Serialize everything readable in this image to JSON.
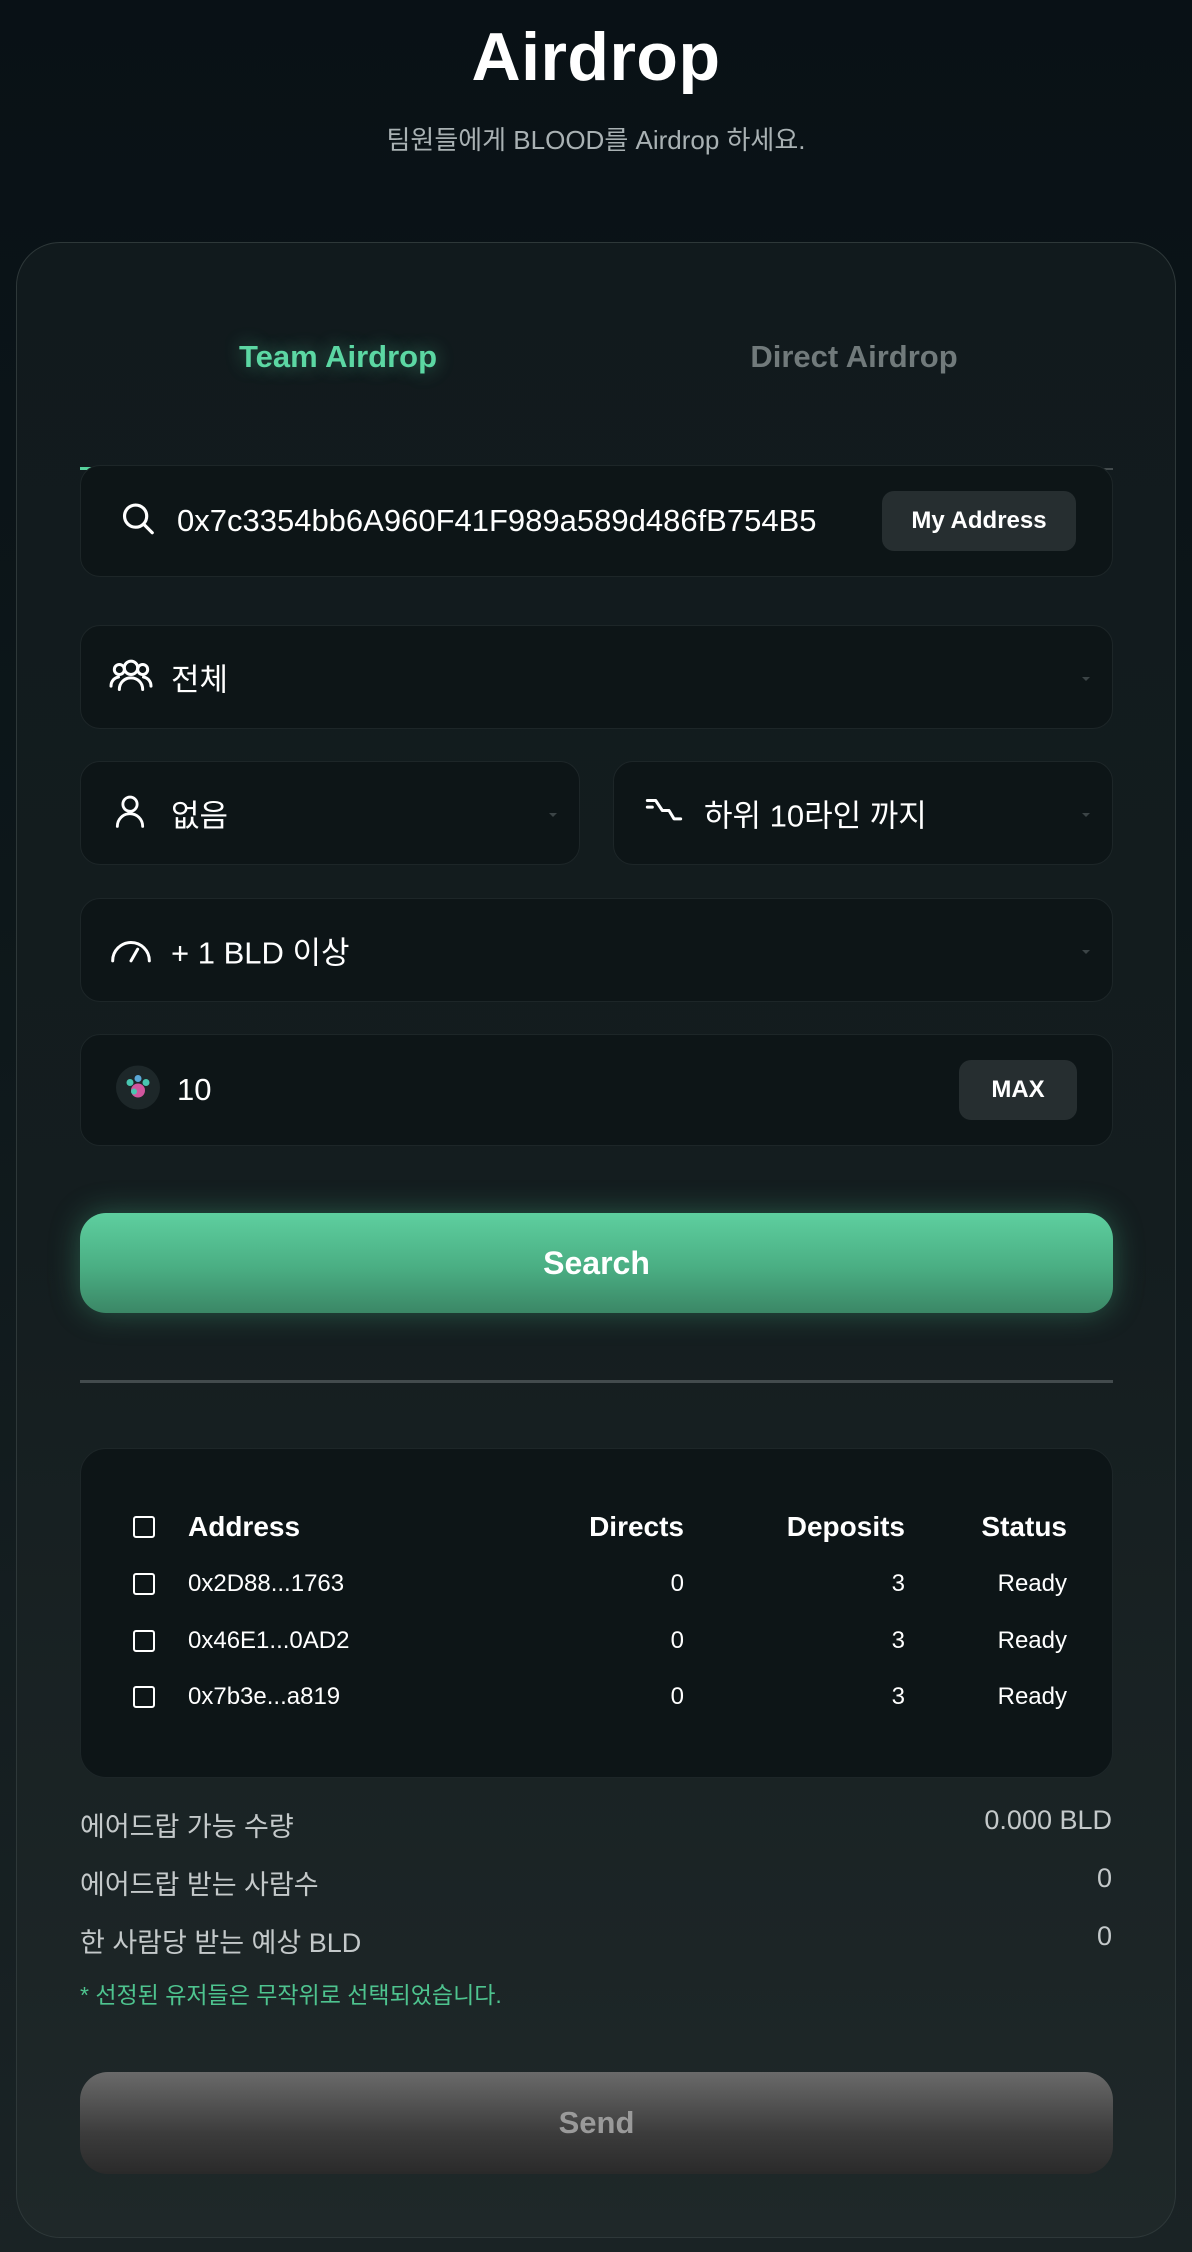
{
  "header": {
    "title": "Airdrop",
    "subtitle": "팀원들에게 BLOOD를 Airdrop 하세요."
  },
  "tabs": [
    {
      "label": "Team Airdrop",
      "active": true
    },
    {
      "label": "Direct Airdrop",
      "active": false
    }
  ],
  "search": {
    "value": "0x7c3354bb6A960F41F989a589d486fB754B5",
    "my_address_label": "My Address"
  },
  "filters": {
    "group": "전체",
    "user": "없음",
    "depth": "하위 10라인 까지",
    "min_amount": "+ 1 BLD 이상"
  },
  "amount": {
    "value": "10",
    "max_label": "MAX"
  },
  "search_button_label": "Search",
  "table": {
    "headers": [
      "Address",
      "Directs",
      "Deposits",
      "Status"
    ],
    "rows": [
      {
        "address": "0x2D88...1763",
        "directs": "0",
        "deposits": "3",
        "status": "Ready"
      },
      {
        "address": "0x46E1...0AD2",
        "directs": "0",
        "deposits": "3",
        "status": "Ready"
      },
      {
        "address": "0x7b3e...a819",
        "directs": "0",
        "deposits": "3",
        "status": "Ready"
      }
    ]
  },
  "summary": [
    {
      "label": "에어드랍 가능 수량",
      "value": "0.000 BLD"
    },
    {
      "label": "에어드랍 받는 사람수",
      "value": "0"
    },
    {
      "label": "한 사람당 받는 예상 BLD",
      "value": "0"
    }
  ],
  "note": "* 선정된 유저들은 무작위로 선택되었습니다.",
  "send_button_label": "Send",
  "colors": {
    "accent": "#5cd7a3",
    "background": "#0d171a",
    "field": "#0d1517"
  }
}
